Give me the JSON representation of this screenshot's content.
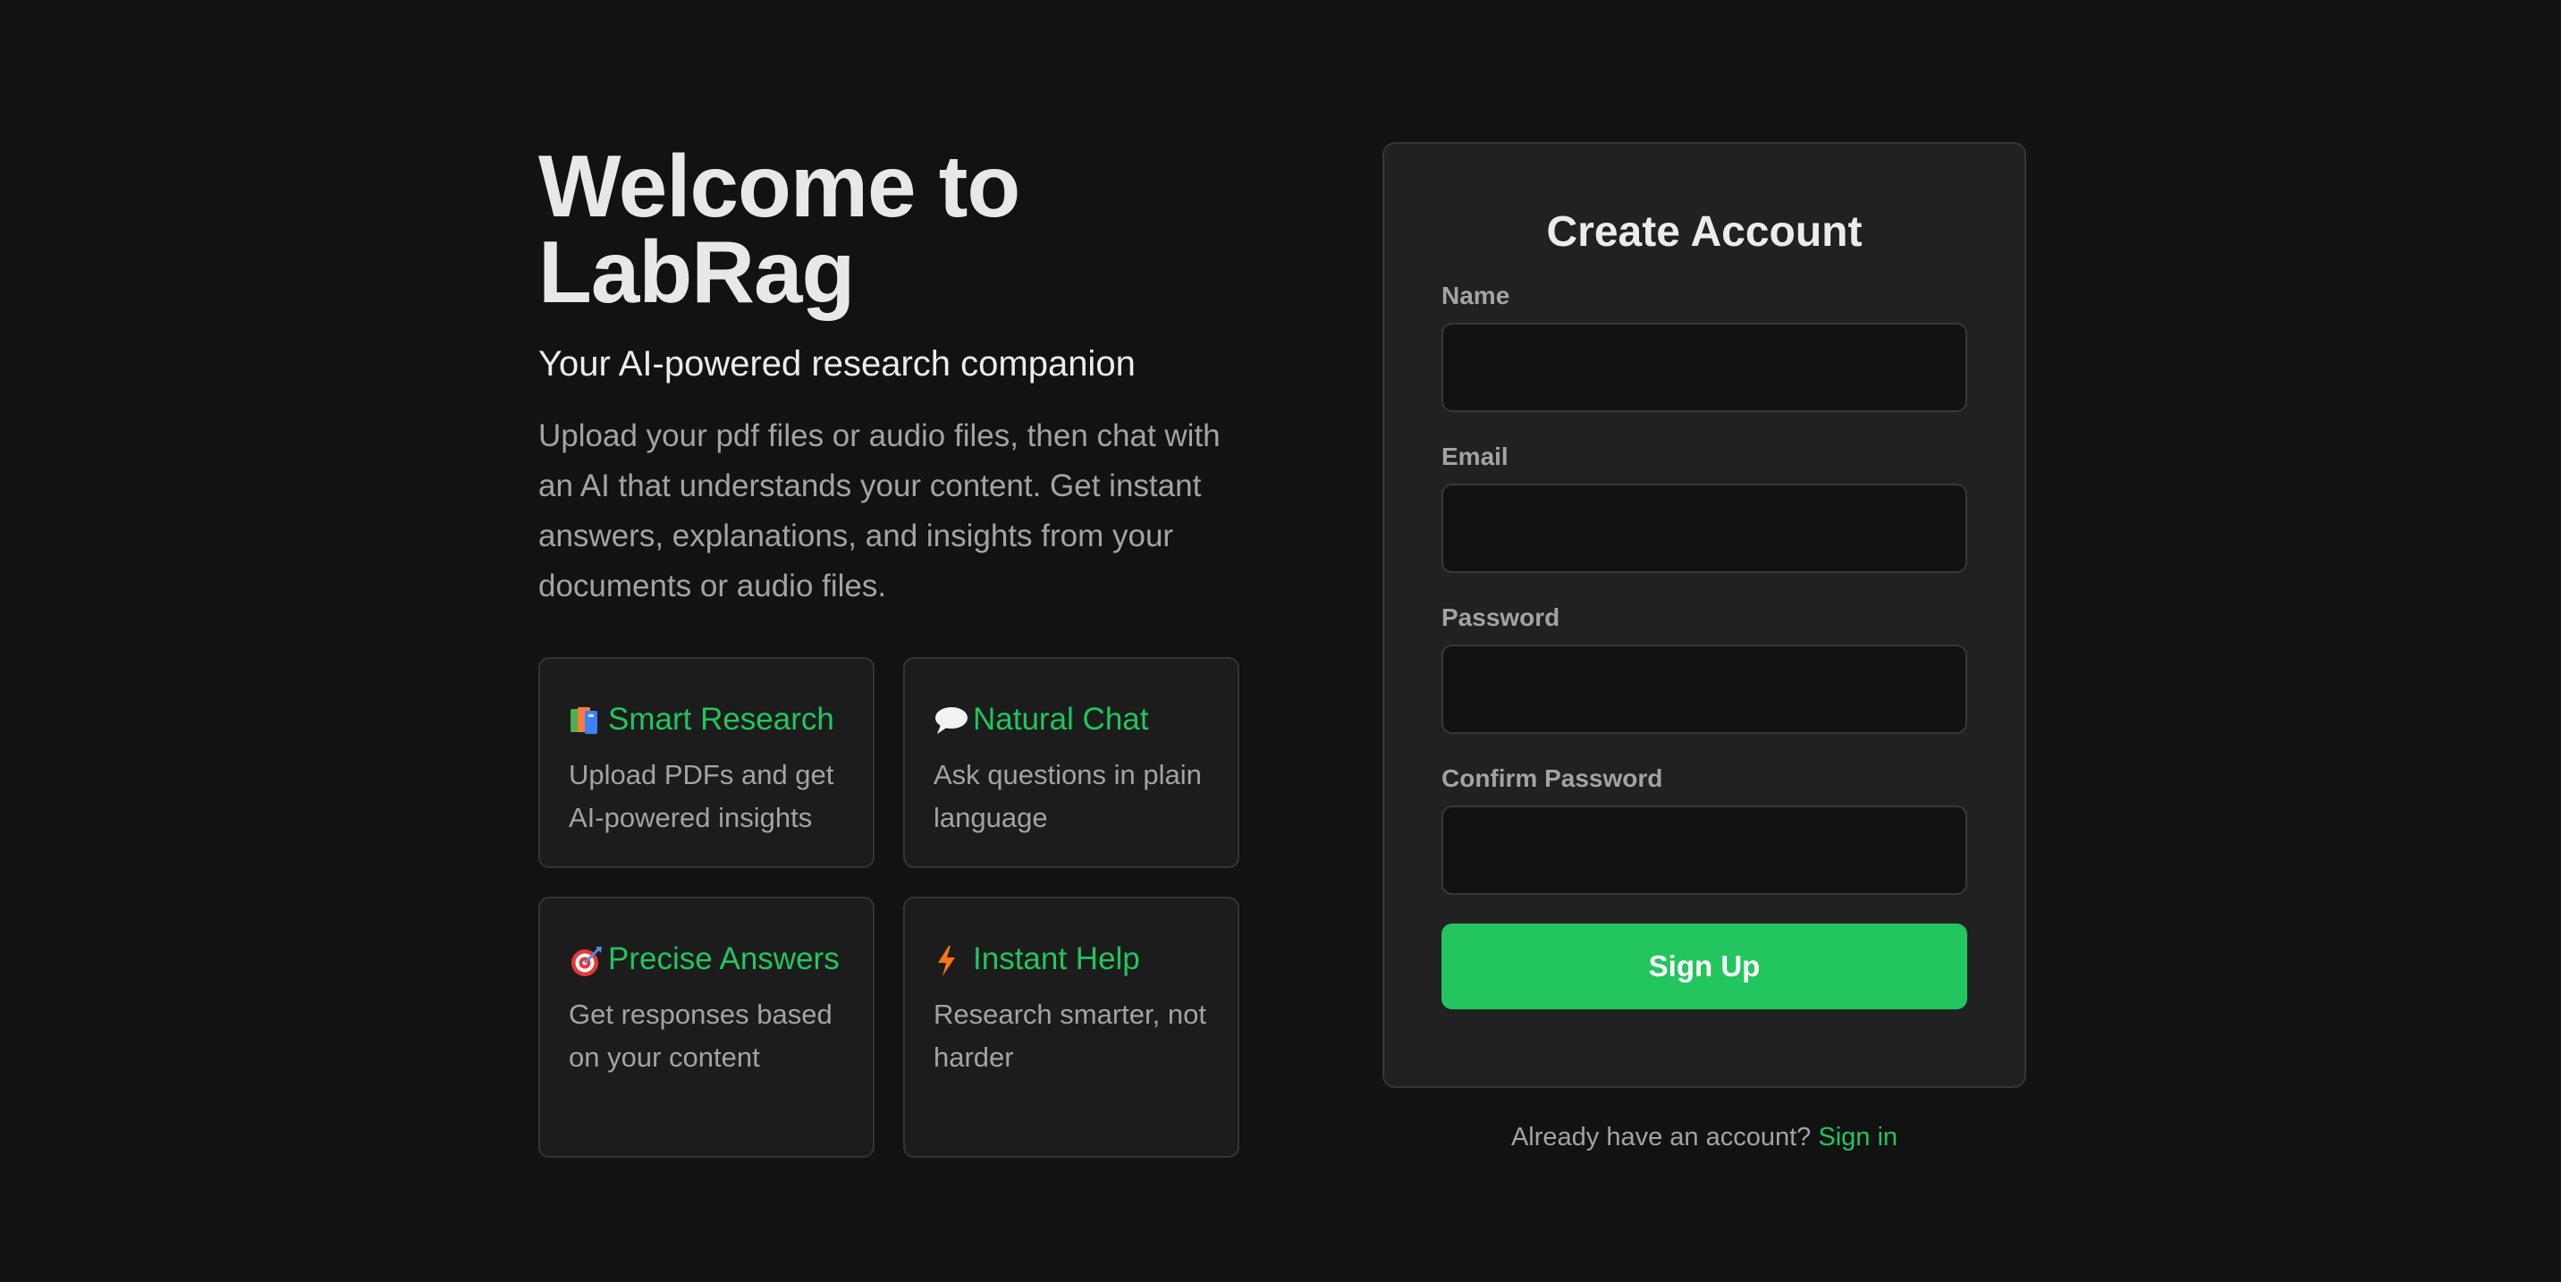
{
  "hero": {
    "title": "Welcome to LabRag",
    "subtitle": "Your AI-powered research companion",
    "description": "Upload your pdf files or audio files, then chat with an AI that understands your content. Get instant answers, explanations, and insights from your documents or audio files."
  },
  "features": [
    {
      "icon": "books-icon",
      "title": "Smart Research",
      "description": "Upload PDFs and get AI-powered insights"
    },
    {
      "icon": "speech-bubble-icon",
      "title": "Natural Chat",
      "description": "Ask questions in plain language"
    },
    {
      "icon": "target-icon",
      "title": "Precise Answers",
      "description": "Get responses based on your content"
    },
    {
      "icon": "lightning-icon",
      "title": "Instant Help",
      "description": "Research smarter, not harder"
    }
  ],
  "form": {
    "title": "Create Account",
    "fields": [
      {
        "label": "Name",
        "value": "",
        "placeholder": ""
      },
      {
        "label": "Email",
        "value": "",
        "placeholder": ""
      },
      {
        "label": "Password",
        "value": "",
        "placeholder": ""
      },
      {
        "label": "Confirm Password",
        "value": "",
        "placeholder": ""
      }
    ],
    "submit_label": "Sign Up",
    "footer_text": "Already have an account?",
    "footer_link": "Sign in"
  },
  "colors": {
    "background": "#121212",
    "card": "#212121",
    "accent": "#22c55e",
    "muted_text": "#a3a3a3"
  }
}
